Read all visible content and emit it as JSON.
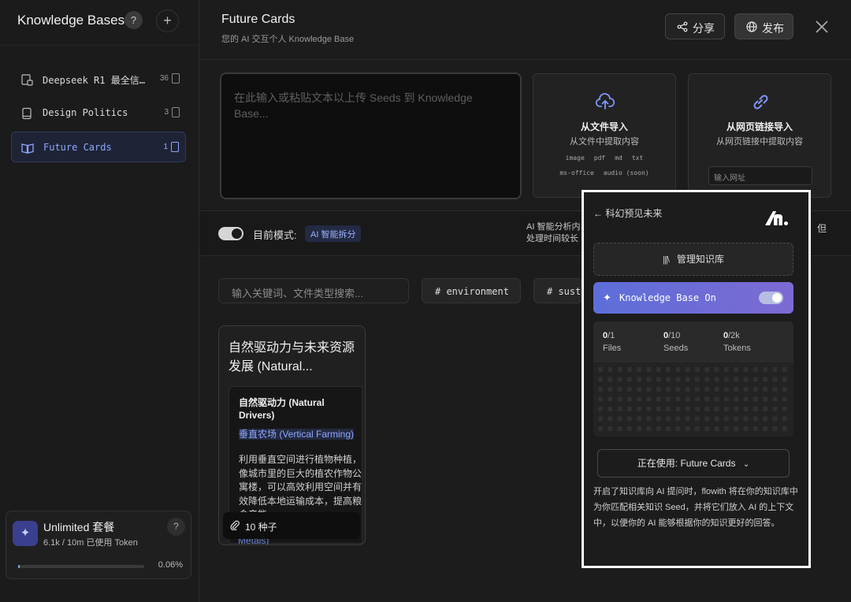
{
  "sidebar": {
    "title": "Knowledge Bases",
    "help": "?",
    "add": "+",
    "items": [
      {
        "label": "Deepseek R1 最全信…",
        "count": "36",
        "active": false
      },
      {
        "label": "Design Politics",
        "count": "3",
        "active": false
      },
      {
        "label": "Future Cards",
        "count": "1",
        "active": true
      }
    ],
    "plan": {
      "name": "Unlimited 套餐",
      "usage": "6.1k / 10m 已使用 Token",
      "help": "?",
      "progress_percent": 0.06,
      "progress_label": "0.06%"
    }
  },
  "header": {
    "title": "Future Cards",
    "subtitle": "您的 AI 交互个人 Knowledge Base",
    "share_label": "分享",
    "publish_label": "发布"
  },
  "upload": {
    "textarea_placeholder": "在此输入或粘贴文本以上传 Seeds 到 Knowledge Base...",
    "file_import": {
      "title": "从文件导入",
      "subtitle": "从文件中提取内容",
      "tags_row1": [
        "image",
        "pdf",
        "md",
        "txt"
      ],
      "tags_row2": [
        "ms-office",
        "audio (soon)"
      ]
    },
    "web_import": {
      "title": "从网页链接导入",
      "subtitle": "从网页链接中提取内容",
      "url_placeholder": "输入网址"
    }
  },
  "mode": {
    "label": "目前模式:",
    "badge": "AI 智能拆分",
    "desc_line1": "AI 智能分析内",
    "desc_line2": "处理时间较长",
    "desc_tail": "但"
  },
  "filter": {
    "search_placeholder": "输入关键词、文件类型搜索...",
    "tags": [
      "# environment",
      "# sust"
    ]
  },
  "seed_card": {
    "title": "自然驱动力与未来资源发展 (Natural...",
    "subtitle": "自然驱动力 (Natural Drivers)",
    "highlight": "垂直农场 (Vertical Farming)",
    "body": "利用垂直空间进行植物种植，像城市里的巨大的植农作物公寓楼，可以高效利用空间并有效降低本地运输成本，提高粮食产能。",
    "trail": "Metals)",
    "footer": "10 种子"
  },
  "popup": {
    "back_label": "科幻预见未来",
    "manage_label": "管理知识库",
    "kb_label": "Knowledge Base On",
    "stats": [
      {
        "value": "0",
        "total": "/1",
        "label": "Files"
      },
      {
        "value": "0",
        "total": "/10",
        "label": "Seeds"
      },
      {
        "value": "0",
        "total": "/2k",
        "label": "Tokens"
      }
    ],
    "using_label": "正在使用: Future Cards",
    "description": "开启了知识库向 AI 提问时，flowith 将在你的知识库中为你匹配相关知识 Seed，并将它们放入 AI 的上下文中，以便你的 AI 能够根据你的知识更好的回答。"
  },
  "colors": {
    "accent": "#8ea6ff",
    "kb_gradient_start": "#5d6ed9",
    "kb_gradient_end": "#7d6ad3",
    "background": "#1c1c1c"
  }
}
